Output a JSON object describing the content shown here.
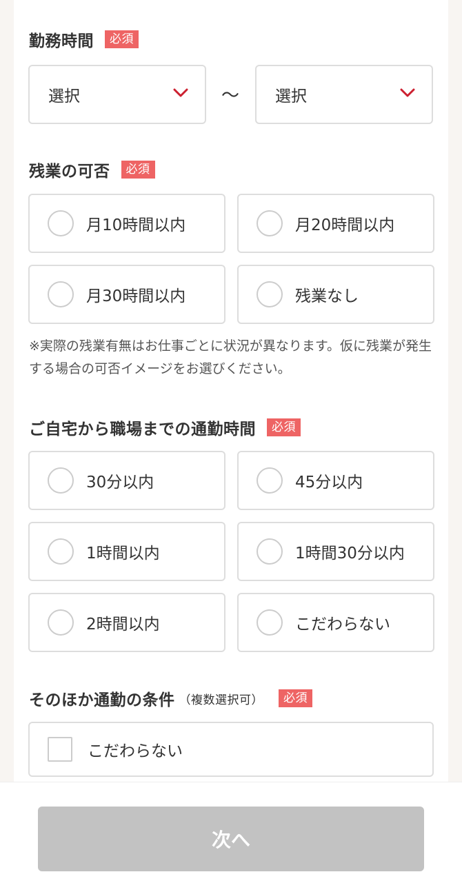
{
  "required_badge": "必須",
  "work_hours": {
    "title": "勤務時間",
    "start_value": "選択",
    "separator": "〜",
    "end_value": "選択"
  },
  "overtime": {
    "title": "残業の可否",
    "options": [
      "月10時間以内",
      "月20時間以内",
      "月30時間以内",
      "残業なし"
    ],
    "note": "※実際の残業有無はお仕事ごとに状況が異なります。仮に残業が発生する場合の可否イメージをお選びください。"
  },
  "commute_time": {
    "title": "ご自宅から職場までの通勤時間",
    "options": [
      "30分以内",
      "45分以内",
      "1時間以内",
      "1時間30分以内",
      "2時間以内",
      "こだわらない"
    ]
  },
  "commute_conditions": {
    "title": "そのほか通勤の条件",
    "subtitle": "（複数選択可）",
    "options": [
      "こだわらない"
    ]
  },
  "footer": {
    "next_label": "次へ"
  },
  "colors": {
    "accent": "#ee6464",
    "chevron": "#cc1f2f",
    "disabled_button": "#c2c2c2",
    "border": "#dddddd"
  }
}
